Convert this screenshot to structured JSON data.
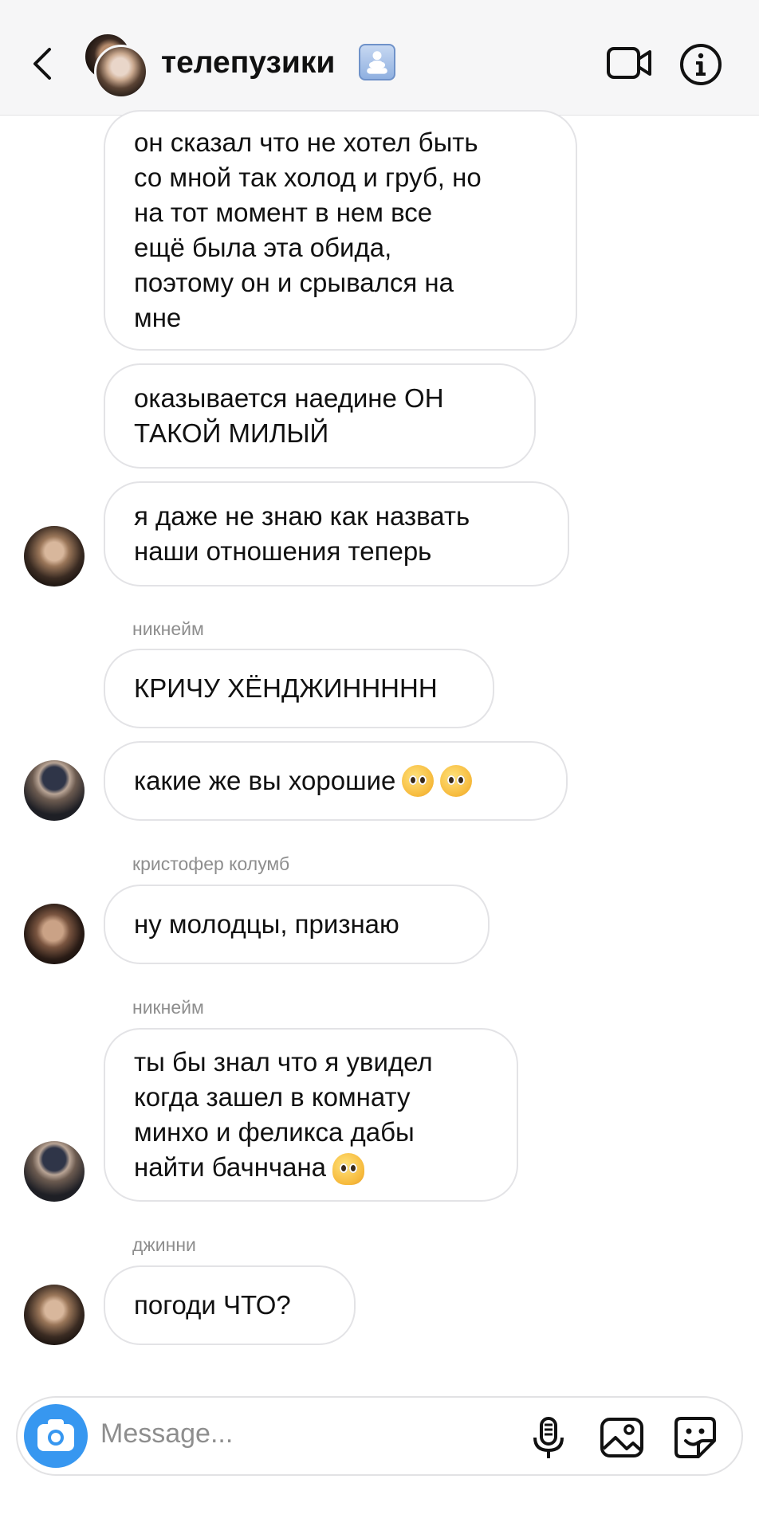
{
  "header": {
    "title": "телепузики",
    "icons": [
      "back-chevron-icon",
      "group-badge-icon",
      "video-call-icon",
      "info-icon"
    ]
  },
  "messages": [
    {
      "sender": "",
      "text": "он сказал что не хотел быть\nсо мной так холод и груб, но\nна тот момент в нем все\nещё была эта обида,\nпоэтому он и срывался на\nмне"
    },
    {
      "sender": "",
      "text": "оказывается наедине ОН\nТАКОЙ МИЛЫЙ"
    },
    {
      "sender": "",
      "text": "я даже не знаю как назвать\nнаши отношения теперь"
    },
    {
      "sender": "никнейм",
      "text": "КРИЧУ ХЁНДЖИННННН"
    },
    {
      "sender": "",
      "text": "какие же вы хорошие"
    },
    {
      "sender": "кристофер колумб",
      "text": "ну молодцы, признаю"
    },
    {
      "sender": "никнейм",
      "text": "ты бы знал что я увидел\nкогда зашел в комнату\nминхо и феликса дабы\nнайти бачнчана"
    },
    {
      "sender": "джинни",
      "text": "погоди ЧТО?"
    }
  ],
  "composer": {
    "placeholder": "Message...",
    "icons": [
      "camera-icon",
      "microphone-icon",
      "gallery-icon",
      "sticker-icon"
    ]
  },
  "colors": {
    "accent": "#3797f0",
    "header_bg": "#f6f6f7",
    "bubble_border": "#e3e3e6",
    "muted_text": "#8e8e8e"
  }
}
